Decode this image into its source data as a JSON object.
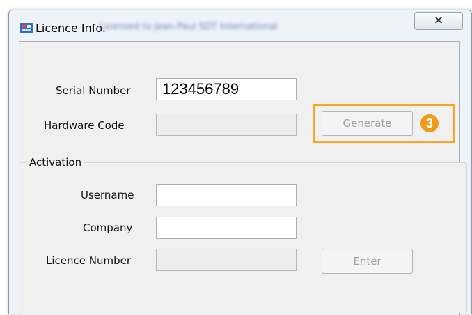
{
  "window": {
    "title": "Licence Info.",
    "title_extra": "Licensed to Jean-Paul SDT International",
    "close_glyph": "✕"
  },
  "form": {
    "serial_label": "Serial Number",
    "serial_value": "123456789",
    "hardware_label": "Hardware Code",
    "hardware_value": "",
    "generate_label": "Generate",
    "step_number": "3"
  },
  "activation": {
    "group_label": "Activation",
    "username_label": "Username",
    "username_value": "",
    "company_label": "Company",
    "company_value": "",
    "licence_label": "Licence Number",
    "licence_value": "",
    "enter_label": "Enter"
  },
  "colors": {
    "highlight": "#f5a623",
    "badge": "#f09b18"
  },
  "icons": {
    "app": "form-app-icon",
    "close": "close-icon"
  }
}
